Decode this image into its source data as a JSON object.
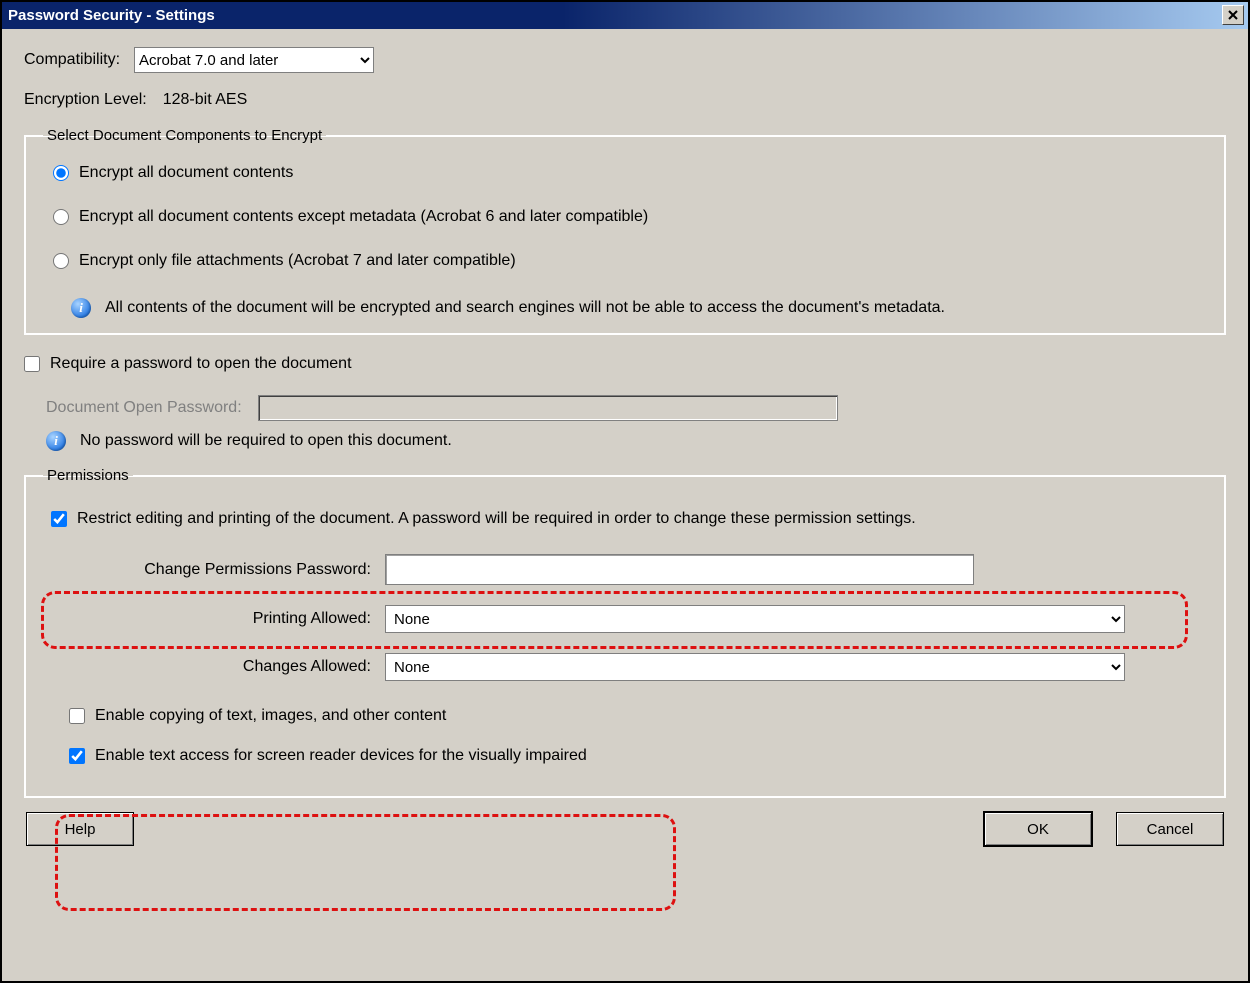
{
  "window": {
    "title": "Password Security - Settings"
  },
  "compatibility": {
    "label": "Compatibility:",
    "selected": "Acrobat 7.0 and later"
  },
  "encryption": {
    "label": "Encryption  Level:",
    "value": "128-bit AES"
  },
  "encrypt_group": {
    "legend": "Select Document Components to Encrypt",
    "opt1": "Encrypt all document contents",
    "opt2": "Encrypt all document contents except metadata (Acrobat 6 and later compatible)",
    "opt3": "Encrypt only file attachments (Acrobat 7 and later compatible)",
    "info": "All contents of the document will be encrypted and search engines will not be able to access the document's metadata."
  },
  "open_pw": {
    "require_label": "Require a password to open the document",
    "pw_label": "Document Open Password:",
    "info": "No password will be required to open this document."
  },
  "permissions": {
    "legend": "Permissions",
    "restrict_label": "Restrict editing and printing of the document. A password will be required in order to change these permission settings.",
    "change_pw_label": "Change Permissions Password:",
    "printing_label": "Printing Allowed:",
    "printing_value": "None",
    "changes_label": "Changes Allowed:",
    "changes_value": "None",
    "enable_copy": "Enable copying of text, images, and other content",
    "enable_access": "Enable text access for screen reader devices for the visually impaired"
  },
  "buttons": {
    "help": "Help",
    "ok": "OK",
    "cancel": "Cancel"
  }
}
